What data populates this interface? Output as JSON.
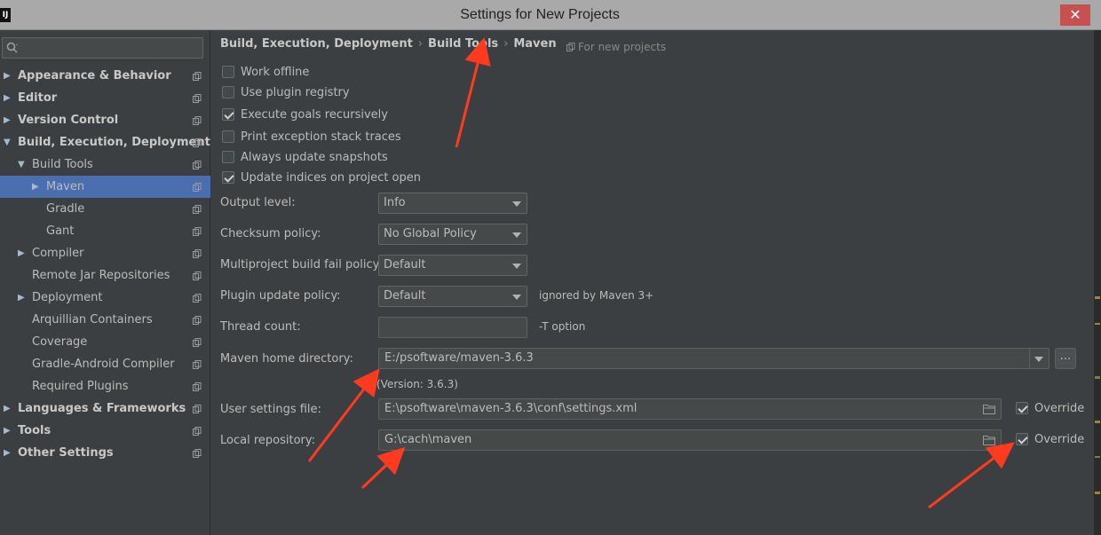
{
  "window": {
    "title": "Settings for New Projects",
    "app_icon": "IJ",
    "close_glyph": "✕"
  },
  "sidebar": {
    "search": {
      "placeholder": "",
      "icon": "search-icon"
    },
    "items": [
      {
        "label": "Appearance & Behavior",
        "level": 0,
        "arrow": "▶",
        "bold": true
      },
      {
        "label": "Editor",
        "level": 0,
        "arrow": "▶",
        "bold": true
      },
      {
        "label": "Version Control",
        "level": 0,
        "arrow": "▶",
        "bold": true
      },
      {
        "label": "Build, Execution, Deployment",
        "level": 0,
        "arrow": "▼",
        "bold": true
      },
      {
        "label": "Build Tools",
        "level": 1,
        "arrow": "▼"
      },
      {
        "label": "Maven",
        "level": 2,
        "arrow": "▶",
        "selected": true
      },
      {
        "label": "Gradle",
        "level": 2,
        "arrow": ""
      },
      {
        "label": "Gant",
        "level": 2,
        "arrow": ""
      },
      {
        "label": "Compiler",
        "level": 1,
        "arrow": "▶"
      },
      {
        "label": "Remote Jar Repositories",
        "level": 1,
        "arrow": ""
      },
      {
        "label": "Deployment",
        "level": 1,
        "arrow": "▶"
      },
      {
        "label": "Arquillian Containers",
        "level": 1,
        "arrow": ""
      },
      {
        "label": "Coverage",
        "level": 1,
        "arrow": ""
      },
      {
        "label": "Gradle-Android Compiler",
        "level": 1,
        "arrow": ""
      },
      {
        "label": "Required Plugins",
        "level": 1,
        "arrow": ""
      },
      {
        "label": "Languages & Frameworks",
        "level": 0,
        "arrow": "▶",
        "bold": true
      },
      {
        "label": "Tools",
        "level": 0,
        "arrow": "▶",
        "bold": true
      },
      {
        "label": "Other Settings",
        "level": 0,
        "arrow": "▶",
        "bold": true
      }
    ]
  },
  "main": {
    "breadcrumb": [
      "Build, Execution, Deployment",
      "Build Tools",
      "Maven"
    ],
    "breadcrumb_sep": "›",
    "scope_note": "For new projects",
    "checkboxes": [
      {
        "label": "Work offline",
        "checked": false
      },
      {
        "label": "Use plugin registry",
        "checked": false
      },
      {
        "label": "Execute goals recursively",
        "checked": true
      },
      {
        "label": "Print exception stack traces",
        "checked": false
      },
      {
        "label": "Always update snapshots",
        "checked": false
      },
      {
        "label": "Update indices on project open",
        "checked": true
      }
    ],
    "output_level": {
      "label": "Output level:",
      "value": "Info"
    },
    "checksum_policy": {
      "label": "Checksum policy:",
      "value": "No Global Policy"
    },
    "fail_policy": {
      "label": "Multiproject build fail policy:",
      "value": "Default"
    },
    "plugin_update_policy": {
      "label": "Plugin update policy:",
      "value": "Default",
      "hint": "ignored by Maven 3+"
    },
    "thread_count": {
      "label": "Thread count:",
      "value": "",
      "hint": "-T option"
    },
    "maven_home": {
      "label": "Maven home directory:",
      "value": "E:/psoftware/maven-3.6.3",
      "version": "(Version: 3.6.3)",
      "browse": "..."
    },
    "user_settings": {
      "label": "User settings file:",
      "value": "E:\\psoftware\\maven-3.6.3\\conf\\settings.xml",
      "override_label": "Override",
      "override_checked": true
    },
    "local_repo": {
      "label": "Local repository:",
      "value": "G:\\cach\\maven",
      "override_label": "Override",
      "override_checked": true
    }
  },
  "colors": {
    "annotation_arrow": "#ff3b1f",
    "selection": "#4b6eaf",
    "background": "#3c3f41",
    "titlebar": "#a9a9a9"
  }
}
